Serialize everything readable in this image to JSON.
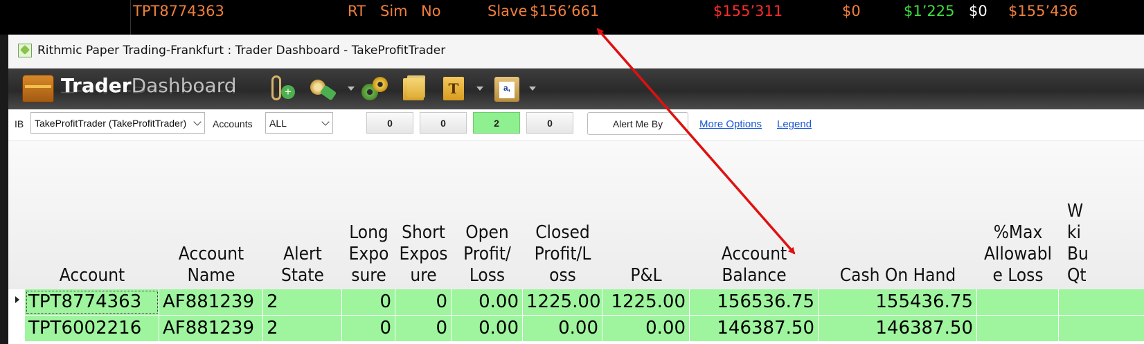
{
  "top_strip": {
    "account": "TPT8774363",
    "c1": "RT",
    "c2": "Sim",
    "c3": "No",
    "c4": "Slave",
    "c5": "$156’661",
    "c6": "$155’311",
    "c7": "$0",
    "c8": "$1’225",
    "c9": "$0",
    "c10": "$155’436",
    "colors": {
      "orange": "#f07f3c",
      "red": "#ff2a2a",
      "green": "#3ddc3d",
      "white": "#ffffff"
    }
  },
  "window": {
    "title": "Rithmic Paper Trading-Frankfurt : Trader Dashboard - TakeProfitTrader"
  },
  "toolbar": {
    "logo_bold": "Trader",
    "logo_light": "Dashboard",
    "icons": [
      "add-attachment-icon",
      "tools-icon",
      "settings-gears-icon",
      "folder-icon",
      "template-document-icon",
      "clipboard-icon"
    ],
    "doc_letter": "T",
    "clipboard_letter": "a,"
  },
  "filters": {
    "ib_label": "IB",
    "ib_value": "TakeProfitTrader (TakeProfitTrader)",
    "accounts_label": "Accounts",
    "accounts_value": "ALL",
    "counters": [
      "0",
      "0",
      "2",
      "0"
    ],
    "alert_button": "Alert Me By",
    "more_options": "More Options",
    "legend": "Legend"
  },
  "grid": {
    "columns": [
      "Account",
      "Account\nName",
      "Alert\nState",
      "Long\nExpo\nsure",
      "Short\nExpos\nure",
      "Open\nProfit/\nLoss",
      "Closed\nProfit/L\noss",
      "P&L",
      "Account\nBalance",
      "Cash On Hand",
      "%Max\nAllowabl\ne Loss",
      "W\nki\nBu\nQt"
    ],
    "rows": [
      [
        "TPT8774363",
        "AF881239",
        "2",
        "0",
        "0",
        "0.00",
        "1225.00",
        "1225.00",
        "156536.75",
        "155436.75",
        "",
        ""
      ],
      [
        "TPT6002216",
        "AF881239",
        "2",
        "0",
        "0",
        "0.00",
        "0.00",
        "0.00",
        "146387.50",
        "146387.50",
        "",
        ""
      ]
    ],
    "row_color": "#9ef59e"
  },
  "annotation": {
    "color": "#e01010"
  }
}
